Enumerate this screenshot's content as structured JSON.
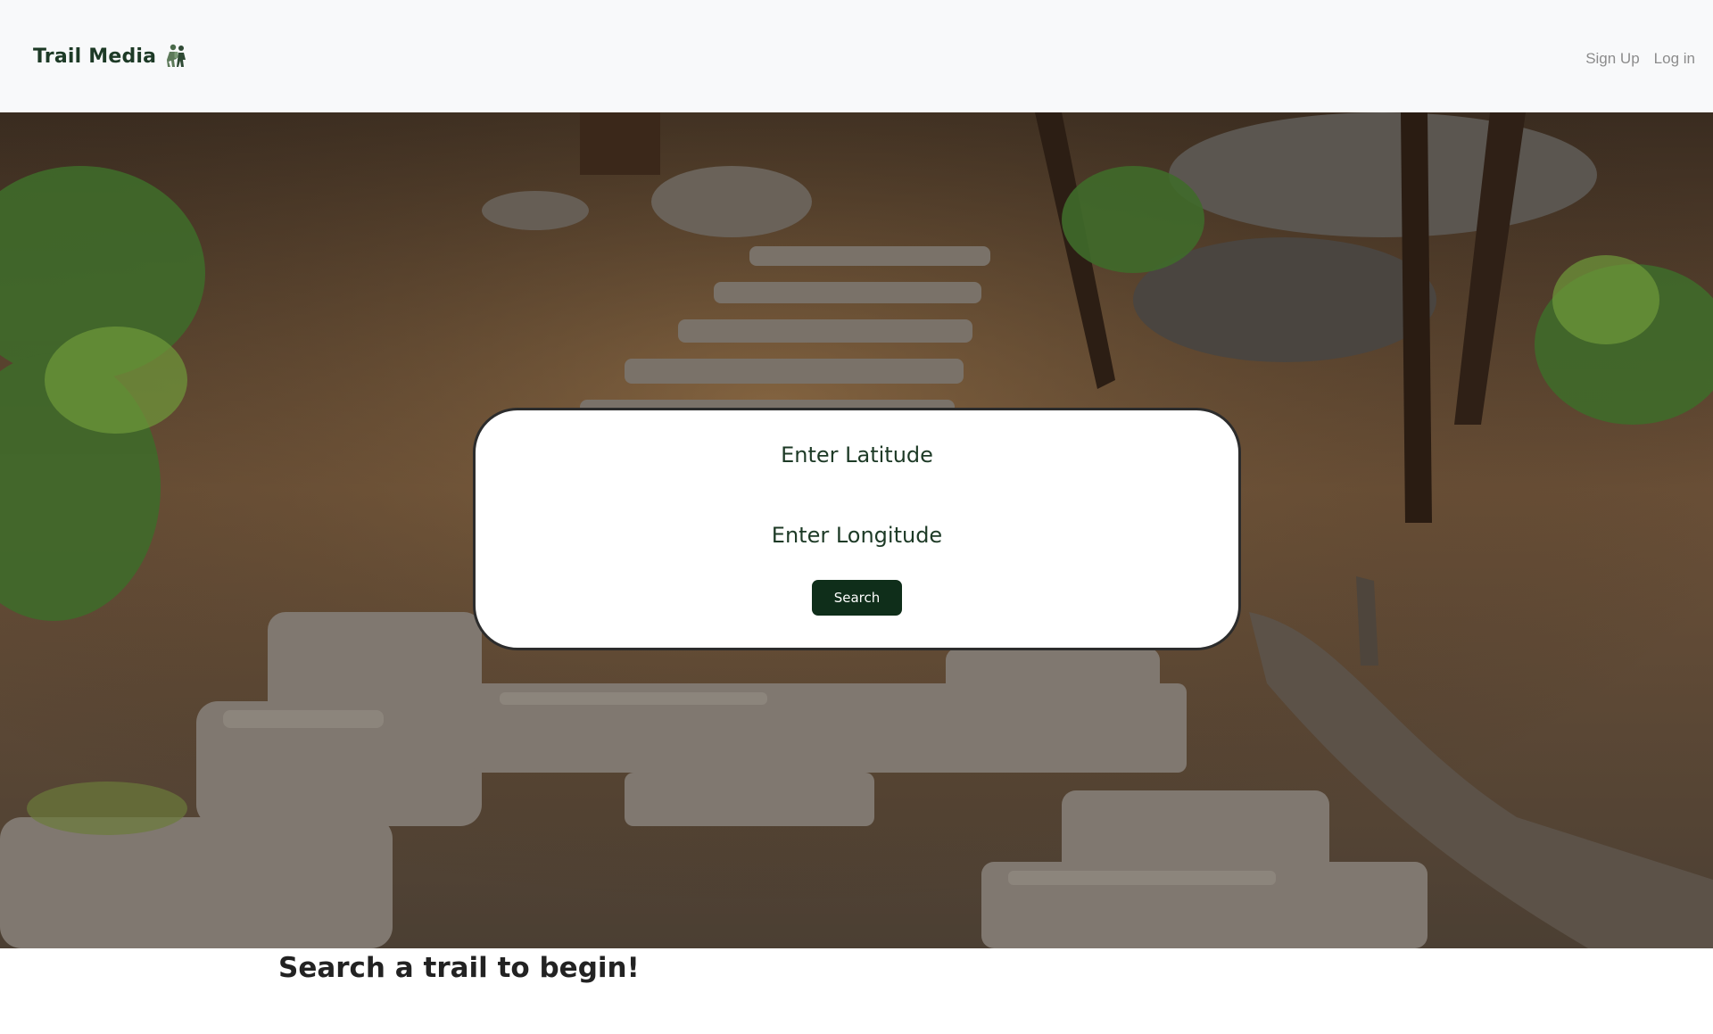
{
  "navbar": {
    "brand": "Trail Media",
    "brand_icon": "hikers-icon",
    "links": {
      "signup": "Sign Up",
      "login": "Log in"
    }
  },
  "hero": {
    "background": "forest-trail-stone-steps-photo",
    "search": {
      "latitude_placeholder": "Enter Latitude",
      "longitude_placeholder": "Enter Longitude",
      "button_label": "Search"
    }
  },
  "main": {
    "prompt": "Search a trail to begin!"
  },
  "colors": {
    "brand": "#1d3a26",
    "button": "#0f2e1a",
    "navbar_bg": "#f8f9fa",
    "nav_link": "#8c8c8c"
  }
}
